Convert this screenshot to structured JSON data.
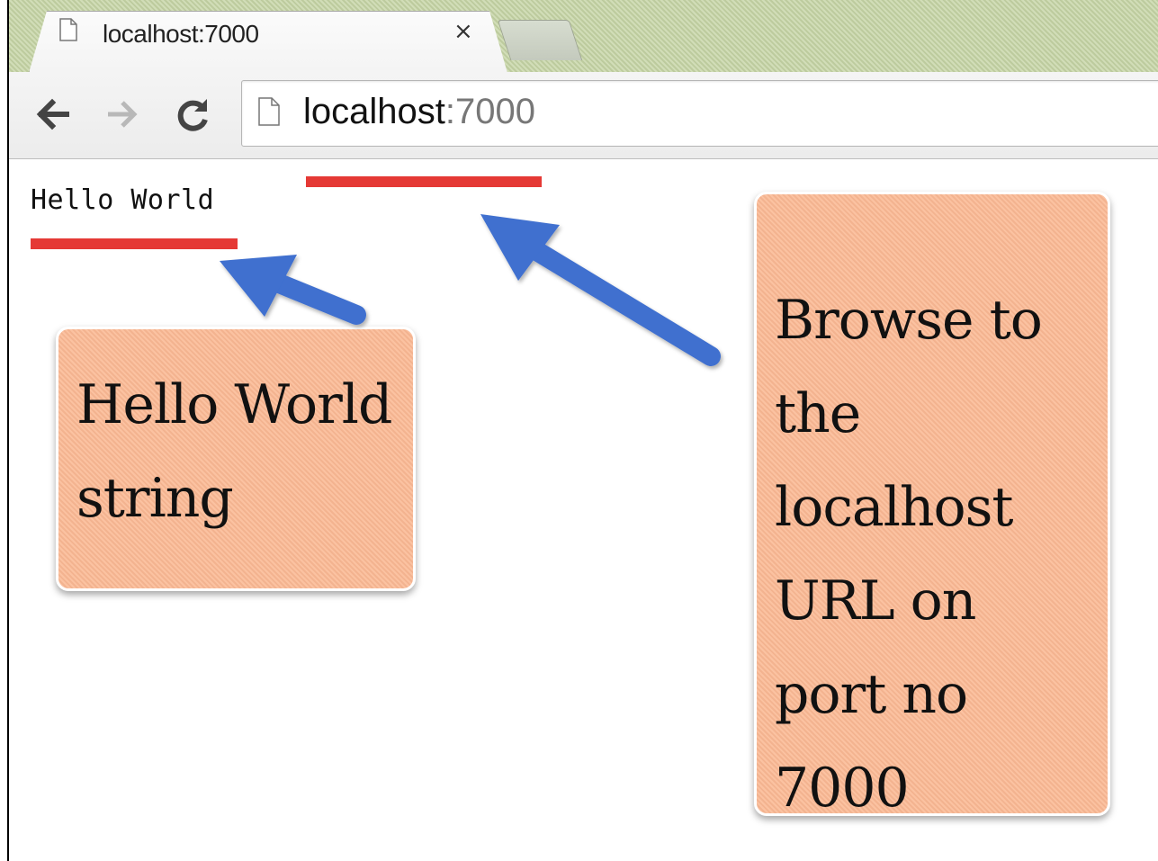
{
  "browser": {
    "tab": {
      "title": "localhost:7000",
      "close_glyph": "×"
    },
    "address_bar": {
      "host": "localhost",
      "port": ":7000"
    }
  },
  "page": {
    "text": "Hello World"
  },
  "annotations": {
    "left_callout": "Hello World string",
    "right_callout": "Browse to the localhost URL on port no 7000"
  },
  "colors": {
    "underline": "#e53935",
    "arrow": "#3f6fcf",
    "callout_fill": "#fbb994",
    "tabstrip": "#c7d6a7"
  },
  "icons": [
    "page-icon",
    "back-arrow-icon",
    "forward-arrow-icon",
    "reload-icon",
    "close-icon"
  ]
}
